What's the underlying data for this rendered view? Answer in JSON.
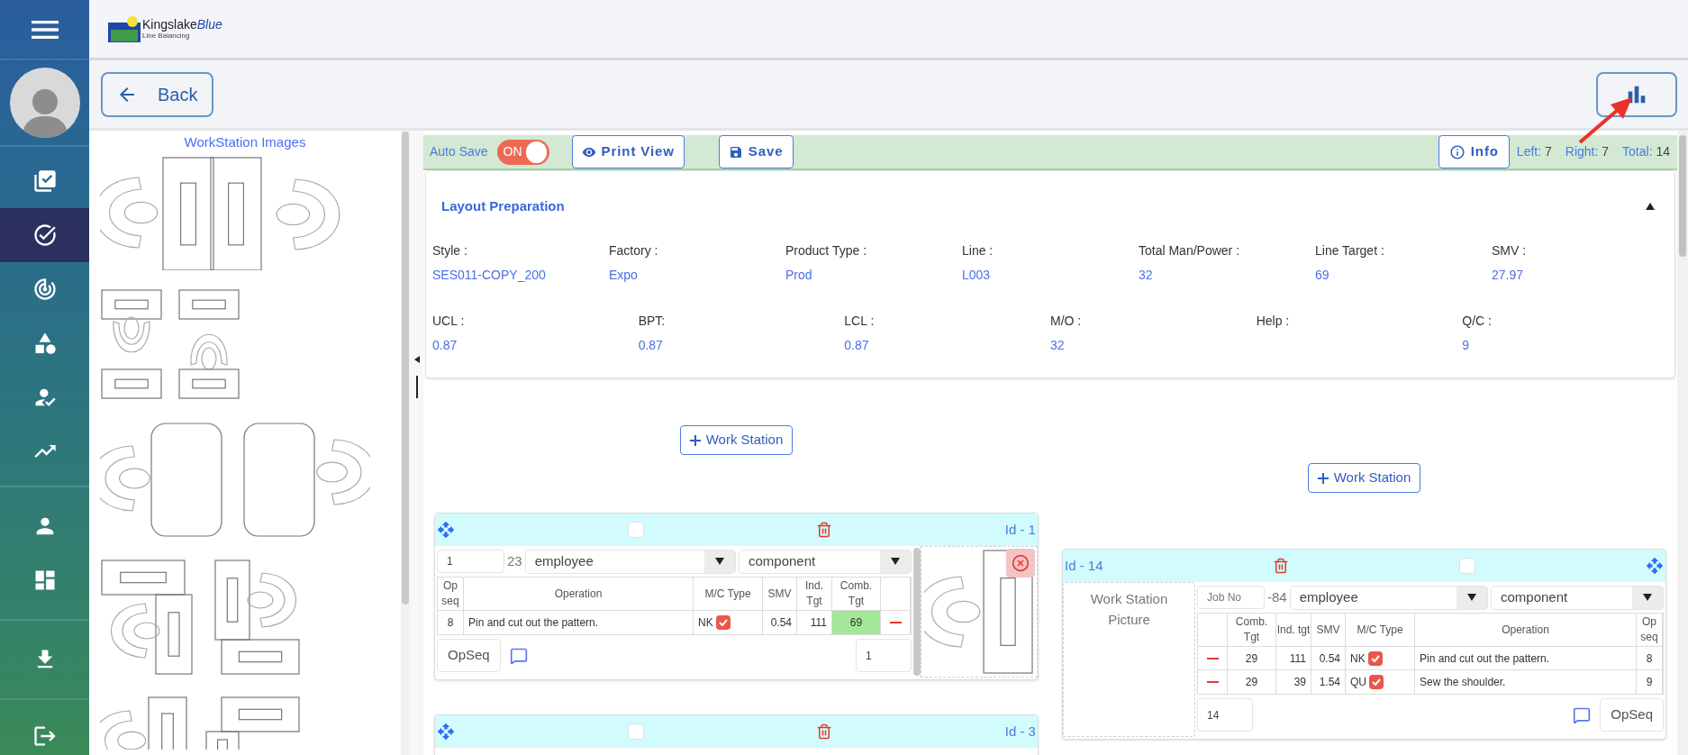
{
  "sidebar": {
    "sections": [
      {
        "items": [
          {
            "selected": false
          },
          {
            "selected": true
          },
          {
            "selected": false
          },
          {
            "selected": false
          },
          {
            "selected": false
          },
          {
            "selected": false
          }
        ]
      },
      {
        "items": [
          {
            "selected": false
          },
          {
            "selected": false
          }
        ]
      },
      {
        "items": [
          {
            "selected": false
          }
        ]
      },
      {
        "items": [
          {
            "selected": false
          }
        ]
      }
    ]
  },
  "logo": {
    "name": "Kingslake",
    "accent": "Blue",
    "subtitle": "Line Balancing"
  },
  "toolbar": {
    "back": "Back"
  },
  "left_panel": {
    "title": "WorkStation Images"
  },
  "action_bar": {
    "auto_save": {
      "label": "Auto Save",
      "on": true,
      "state_text": "ON"
    },
    "buttons": [
      {
        "kind": "print",
        "label": "Print View"
      },
      {
        "kind": "save",
        "label": "Save"
      }
    ],
    "info": "Info",
    "counts": [
      {
        "label": "Left:",
        "value": "7"
      },
      {
        "label": "Right:",
        "value": "7"
      },
      {
        "label": "Total:",
        "value": "14"
      }
    ]
  },
  "layout_preparation": {
    "title": "Layout Preparation",
    "expanded": true,
    "rows": [
      [
        {
          "label": "Style :",
          "value": "SES011-COPY_200"
        },
        {
          "label": "Factory :",
          "value": "Expo"
        },
        {
          "label": "Product Type :",
          "value": "Prod"
        },
        {
          "label": "Line :",
          "value": "L003"
        },
        {
          "label": "Total Man/Power :",
          "value": "32"
        },
        {
          "label": "Line Target :",
          "value": "69"
        },
        {
          "label": "SMV :",
          "value": "27.97"
        }
      ],
      [
        {
          "label": "UCL :",
          "value": "0.87"
        },
        {
          "label": "BPT:",
          "value": "0.87"
        },
        {
          "label": "LCL :",
          "value": "0.87"
        },
        {
          "label": "M/O :",
          "value": "32"
        },
        {
          "label": "Help :"
        },
        {
          "label": "Q/C :",
          "value": "9"
        }
      ]
    ]
  },
  "columns": [
    {
      "add_label": "Work Station",
      "stations": [
        {
          "id": "Id - 1",
          "checked": false,
          "job_no": {
            "value": "1"
          },
          "number": "23",
          "employee": "employee",
          "component": "component",
          "columns": [
            {
              "kind": "op_seq",
              "label": "Op seq"
            },
            {
              "kind": "operation",
              "label": "Operation"
            },
            {
              "kind": "mc_type",
              "label": "M/C Type"
            },
            {
              "kind": "smv",
              "label": "SMV"
            },
            {
              "kind": "ind_tgt",
              "label": "Ind. Tgt"
            },
            {
              "kind": "comb_tgt",
              "label": "Comb. Tgt"
            },
            {
              "kind": "remove"
            }
          ],
          "rows": [
            {
              "op_seq": "8",
              "operation": "Pin and cut out the pattern.",
              "mc_type": "NK",
              "mc_checked": true,
              "smv": "0.54",
              "ind_tgt": "111",
              "comb_tgt": "69",
              "highlighted": true
            }
          ],
          "opseq_button": "OpSeq",
          "count": "1",
          "picture": {
            "kind": "drawing"
          }
        },
        {
          "id": "Id - 3",
          "checked": false
        }
      ]
    },
    {
      "add_label": "Work Station",
      "stations": [
        {
          "id": "Id - 14",
          "checked": false,
          "job_no": {
            "placeholder": "Job No"
          },
          "number": "-84",
          "employee": "employee",
          "component": "component",
          "columns": [
            {
              "kind": "remove"
            },
            {
              "kind": "comb_tgt",
              "label": "Comb. Tgt"
            },
            {
              "kind": "ind_tgt",
              "label": "Ind. tgt"
            },
            {
              "kind": "smv",
              "label": "SMV"
            },
            {
              "kind": "mc_type",
              "label": "M/C Type"
            },
            {
              "kind": "operation",
              "label": "Operation"
            },
            {
              "kind": "op_seq",
              "label": "Op seq"
            }
          ],
          "rows": [
            {
              "op_seq": "8",
              "operation": "Pin and cut out the pattern.",
              "mc_type": "NK",
              "mc_checked": true,
              "smv": "0.54",
              "ind_tgt": "111",
              "comb_tgt": "29",
              "highlighted": false
            },
            {
              "op_seq": "9",
              "operation": "Sew the shoulder.",
              "mc_type": "QU",
              "mc_checked": true,
              "smv": "1.54",
              "ind_tgt": "39",
              "comb_tgt": "29",
              "highlighted": false
            }
          ],
          "opseq_button": "OpSeq",
          "count": "14",
          "picture": {
            "kind": "placeholder",
            "text": "Work Station Picture"
          }
        }
      ]
    }
  ]
}
